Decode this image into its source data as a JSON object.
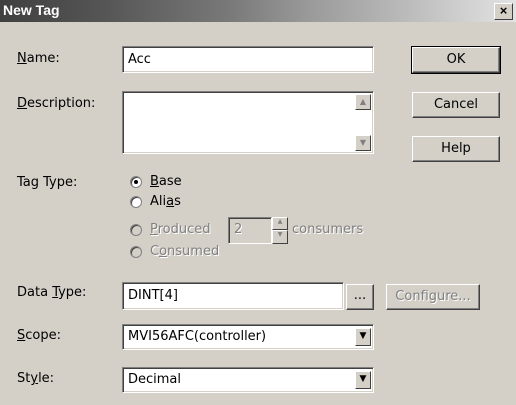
{
  "window": {
    "title": "New Tag",
    "close_glyph": "×"
  },
  "labels": {
    "name_access_key": "N",
    "name_rest": "ame:",
    "description_access_key": "D",
    "description_rest": "escription:",
    "tag_type": "Tag Type:",
    "data_type_prefix": "Data ",
    "data_type_access_key": "T",
    "data_type_rest": "ype:",
    "scope_access_key": "S",
    "scope_rest": "cope:",
    "style_prefix": "St",
    "style_access_key": "y",
    "style_rest": "le:"
  },
  "fields": {
    "name_value": "Acc",
    "description_value": "",
    "data_type_value": "DINT[4]",
    "scope_value": "MVI56AFC(controller)",
    "style_value": "Decimal",
    "consumers_value": "2",
    "consumers_label": "consumers"
  },
  "tag_type_options": {
    "base_access_key": "B",
    "base_rest": "ase",
    "alias_prefix": "Ali",
    "alias_access_key": "a",
    "alias_rest": "s",
    "produced_access_key": "P",
    "produced_rest": "roduced",
    "consumed_prefix": "C",
    "consumed_access_key": "o",
    "consumed_rest": "nsumed",
    "selected": "Base"
  },
  "buttons": {
    "ok": "OK",
    "cancel": "Cancel",
    "help": "Help",
    "browse": "...",
    "configure": "Configure..."
  },
  "icons": {
    "scroll_up": "▲",
    "scroll_down": "▼",
    "combo_arrow": "▼",
    "spin_up": "▲",
    "spin_down": "▼"
  }
}
